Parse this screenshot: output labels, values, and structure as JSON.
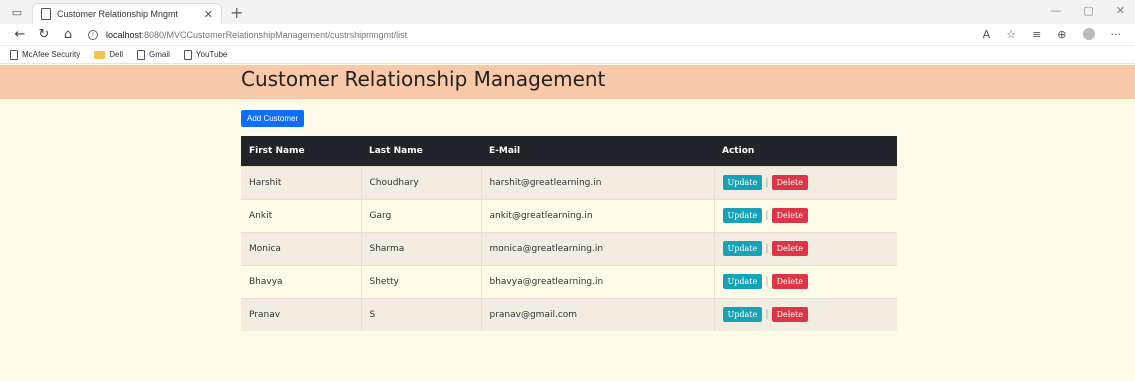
{
  "browser": {
    "tab_title": "Customer Relationship Mngmt",
    "tab_close": "✕",
    "new_tab": "+",
    "url_host": "localhost",
    "url_path": ":8080/MVCCustomerRelationshipManagement/custrshipmngmt/list",
    "bookmarks": [
      {
        "label": "McAfee Security",
        "icon": "page-icon"
      },
      {
        "label": "Dell",
        "icon": "folder-icon"
      },
      {
        "label": "Gmail",
        "icon": "page-icon"
      },
      {
        "label": "YouTube",
        "icon": "page-icon"
      }
    ]
  },
  "page": {
    "heading": "Customer Relationship Management",
    "add_button": "Add Customer"
  },
  "table": {
    "headers": [
      "First Name",
      "Last Name",
      "E-Mail",
      "Action"
    ],
    "update_label": "Update",
    "delete_label": "Delete",
    "separator": "|",
    "rows": [
      {
        "first": "Harshit",
        "last": "Choudhary",
        "email": "harshit@greatlearning.in"
      },
      {
        "first": "Ankit",
        "last": "Garg",
        "email": "ankit@greatlearning.in"
      },
      {
        "first": "Monica",
        "last": "Sharma",
        "email": "monica@greatlearning.in"
      },
      {
        "first": "Bhavya",
        "last": "Shetty",
        "email": "bhavya@greatlearning.in"
      },
      {
        "first": "Pranav",
        "last": "S",
        "email": "pranav@gmail.com"
      }
    ]
  },
  "colors": {
    "header_band": "#f7c9a8",
    "page_bg": "#fffbe9",
    "table_head": "#212529",
    "add_button": "#0d6efd",
    "update_button": "#17a2b8",
    "delete_button": "#dc3545"
  }
}
